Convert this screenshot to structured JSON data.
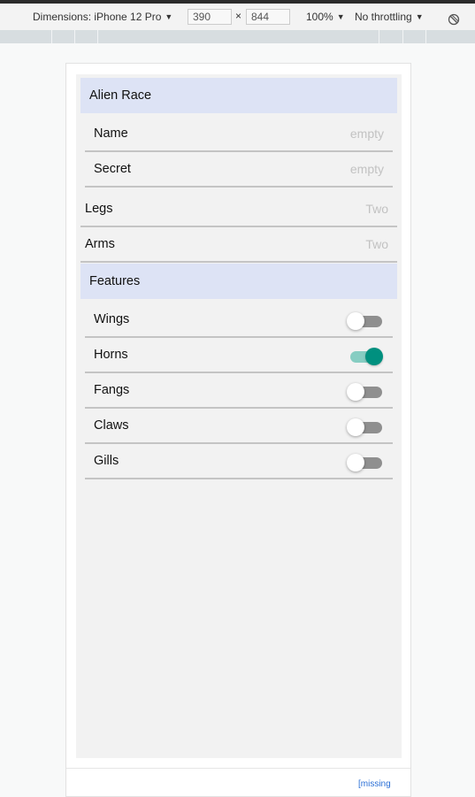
{
  "devtools": {
    "device_label": "Dimensions: iPhone 12 Pro",
    "width": "390",
    "times": "×",
    "height": "844",
    "zoom": "100%",
    "throttling": "No throttling",
    "rotate_icon": "rotate-icon"
  },
  "form": {
    "section1_title": "Alien Race",
    "name": {
      "label": "Name",
      "placeholder": "empty"
    },
    "secret": {
      "label": "Secret",
      "placeholder": "empty"
    },
    "legs": {
      "label": "Legs",
      "value": "Two"
    },
    "arms": {
      "label": "Arms",
      "value": "Two"
    },
    "section2_title": "Features",
    "features": [
      {
        "label": "Wings",
        "on": false
      },
      {
        "label": "Horns",
        "on": true
      },
      {
        "label": "Fangs",
        "on": false
      },
      {
        "label": "Claws",
        "on": false
      },
      {
        "label": "Gills",
        "on": false
      }
    ]
  },
  "colors": {
    "header_bg": "#dde3f5",
    "toggle_on": "#00907f",
    "toggle_on_track": "#86cdc2",
    "toggle_off_track": "#8f8f8f"
  },
  "footer": {
    "link_text": "[missing"
  }
}
